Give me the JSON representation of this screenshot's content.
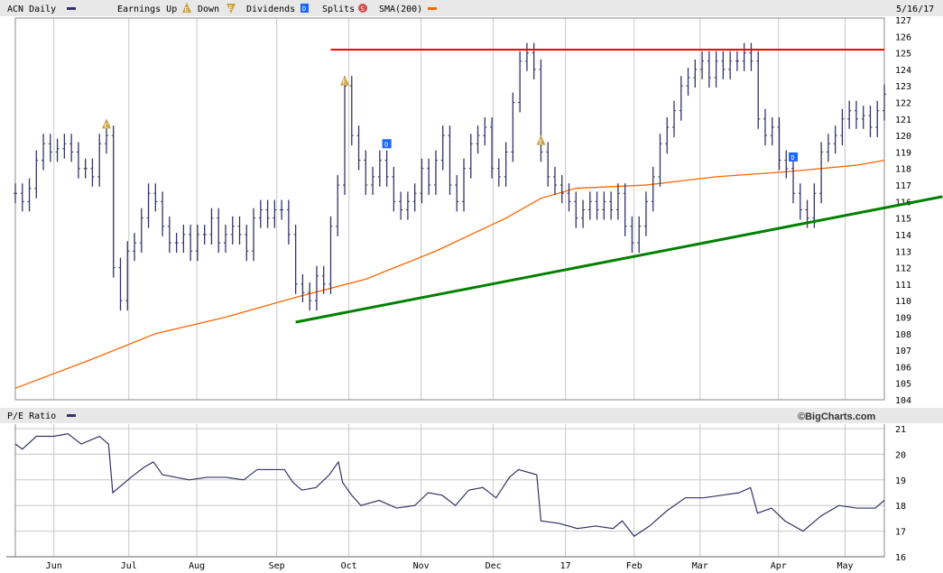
{
  "header": {
    "symbol_label": "ACN Daily",
    "earnings_label": "Earnings Up",
    "down_label": "Down",
    "dividends_label": "Dividends",
    "splits_label": "Splits",
    "sma_label": "SMA(200)",
    "date": "5/16/17",
    "earnings_icon_text": "E",
    "dividend_icon_text": "D",
    "split_icon_text": "S"
  },
  "pe_header": {
    "label": "P/E Ratio",
    "brand": "©BigCharts.com"
  },
  "colors": {
    "price": "#333366",
    "sma": "#ff6600",
    "resistance": "#ff0000",
    "support": "#008000",
    "earnings": "#c8a040",
    "dividend": "#1a66ff",
    "split": "#d05050",
    "grid": "#c8c8c8"
  },
  "chart_data": [
    {
      "type": "line",
      "title": "ACN Daily",
      "subtype": "ohlc-bars",
      "x_index_range": [
        0,
        124
      ],
      "ylim": [
        104,
        127
      ],
      "y_ticks": [
        104,
        105,
        106,
        107,
        108,
        109,
        110,
        111,
        112,
        113,
        114,
        115,
        116,
        117,
        118,
        119,
        120,
        121,
        122,
        123,
        124,
        125,
        126,
        127
      ],
      "month_ticks": [
        {
          "label": "Jun",
          "k": 5.5
        },
        {
          "label": "Jul",
          "k": 16.2
        },
        {
          "label": "Aug",
          "k": 25.9
        },
        {
          "label": "Sep",
          "k": 37.3
        },
        {
          "label": "Oct",
          "k": 47.6
        },
        {
          "label": "Nov",
          "k": 57.9
        },
        {
          "label": "Dec",
          "k": 68.2
        },
        {
          "label": "17",
          "k": 78.5
        },
        {
          "label": "Feb",
          "k": 88.3
        },
        {
          "label": "Mar",
          "k": 97.7
        },
        {
          "label": "Apr",
          "k": 108.9
        },
        {
          "label": "May",
          "k": 118.4
        }
      ],
      "closes": [
        116.5,
        116,
        116.8,
        118.5,
        119.5,
        119,
        119.2,
        119.5,
        119,
        118,
        118,
        117.5,
        119.5,
        120,
        112,
        110,
        113,
        113.5,
        115,
        116.5,
        116,
        114.5,
        113.5,
        113.5,
        114,
        113,
        114,
        114,
        115,
        113.5,
        114,
        114.5,
        114,
        113,
        115,
        115.5,
        115,
        115.5,
        115.5,
        114,
        111,
        110.5,
        110,
        111.5,
        111,
        114.5,
        117,
        123,
        120,
        118.5,
        117,
        117.5,
        118.5,
        117.5,
        116,
        115.5,
        116,
        116.5,
        118,
        117,
        118.5,
        120,
        117,
        116,
        118,
        119.5,
        120,
        120.5,
        118,
        117.5,
        119,
        122,
        124.5,
        125,
        124,
        119,
        117.5,
        117,
        116.5,
        116,
        115,
        115.5,
        116,
        115.5,
        116,
        115.5,
        116.5,
        114.5,
        113.5,
        114.5,
        116,
        117.5,
        119.5,
        120.5,
        121.5,
        123,
        123.5,
        124,
        124.5,
        123.5,
        124.5,
        124,
        124.5,
        124.5,
        125,
        124.5,
        121,
        120,
        120.5,
        118.5,
        118,
        116.5,
        115.5,
        115,
        116.5,
        119,
        119.5,
        120,
        121,
        121.5,
        121,
        121.2,
        120.5,
        121.5,
        122.5
      ],
      "sma200": [
        [
          0,
          104.7
        ],
        [
          10,
          106.3
        ],
        [
          20,
          108
        ],
        [
          30,
          109
        ],
        [
          40,
          110.2
        ],
        [
          50,
          111.3
        ],
        [
          60,
          113
        ],
        [
          70,
          115
        ],
        [
          75,
          116.2
        ],
        [
          80,
          116.8
        ],
        [
          90,
          117
        ],
        [
          100,
          117.5
        ],
        [
          110,
          117.8
        ],
        [
          120,
          118.2
        ],
        [
          124,
          118.5
        ]
      ],
      "trendlines": [
        {
          "name": "resistance",
          "from": [
            45,
            125.2
          ],
          "to": [
            124,
            125.2
          ]
        },
        {
          "name": "support",
          "from": [
            40,
            108.7
          ],
          "to": [
            132.3,
            116.3
          ]
        }
      ],
      "events": [
        {
          "type": "earnings-up",
          "k": 13,
          "price": 120.7
        },
        {
          "type": "earnings-up",
          "k": 47,
          "price": 123.3
        },
        {
          "type": "earnings-up",
          "k": 75,
          "price": 119.7
        },
        {
          "type": "dividend",
          "k": 53,
          "price": 119.5
        },
        {
          "type": "dividend",
          "k": 111,
          "price": 118.7
        }
      ]
    },
    {
      "type": "line",
      "title": "P/E Ratio",
      "ylim": [
        16,
        21
      ],
      "y_ticks": [
        16,
        17,
        18,
        19,
        20,
        21
      ],
      "points": [
        [
          0,
          20.4
        ],
        [
          1,
          20.2
        ],
        [
          3,
          20.7
        ],
        [
          5.5,
          20.7
        ],
        [
          7.5,
          20.8
        ],
        [
          9.4,
          20.4
        ],
        [
          12,
          20.7
        ],
        [
          13.3,
          20.4
        ],
        [
          13.9,
          18.5
        ],
        [
          15.2,
          18.8
        ],
        [
          16.5,
          19.1
        ],
        [
          18.4,
          19.5
        ],
        [
          19.7,
          19.7
        ],
        [
          21,
          19.2
        ],
        [
          22.9,
          19.1
        ],
        [
          24.8,
          19.0
        ],
        [
          27.4,
          19.1
        ],
        [
          30,
          19.1
        ],
        [
          32.6,
          19.0
        ],
        [
          34.5,
          19.4
        ],
        [
          36.4,
          19.4
        ],
        [
          38.4,
          19.4
        ],
        [
          39.6,
          18.9
        ],
        [
          40.9,
          18.6
        ],
        [
          42.9,
          18.7
        ],
        [
          44.8,
          19.2
        ],
        [
          46.1,
          19.7
        ],
        [
          46.7,
          18.9
        ],
        [
          48,
          18.4
        ],
        [
          49.3,
          18.0
        ],
        [
          51.9,
          18.2
        ],
        [
          54.4,
          17.9
        ],
        [
          57,
          18.0
        ],
        [
          58.9,
          18.5
        ],
        [
          60.9,
          18.4
        ],
        [
          62.8,
          18.0
        ],
        [
          64.7,
          18.6
        ],
        [
          66.7,
          18.7
        ],
        [
          68.6,
          18.3
        ],
        [
          70.5,
          19.1
        ],
        [
          71.8,
          19.4
        ],
        [
          74.4,
          19.2
        ],
        [
          75,
          17.4
        ],
        [
          77.6,
          17.3
        ],
        [
          80.2,
          17.1
        ],
        [
          82.8,
          17.2
        ],
        [
          85.3,
          17.1
        ],
        [
          86.6,
          17.4
        ],
        [
          88.3,
          16.8
        ],
        [
          90.5,
          17.2
        ],
        [
          93,
          17.8
        ],
        [
          95.6,
          18.3
        ],
        [
          98.2,
          18.3
        ],
        [
          100.8,
          18.4
        ],
        [
          103.3,
          18.5
        ],
        [
          104.9,
          18.7
        ],
        [
          105.9,
          17.7
        ],
        [
          107.9,
          17.9
        ],
        [
          109.8,
          17.4
        ],
        [
          112.4,
          17.0
        ],
        [
          115,
          17.6
        ],
        [
          117.5,
          18.0
        ],
        [
          120.1,
          17.9
        ],
        [
          122.7,
          17.9
        ],
        [
          124,
          18.2
        ]
      ]
    }
  ]
}
